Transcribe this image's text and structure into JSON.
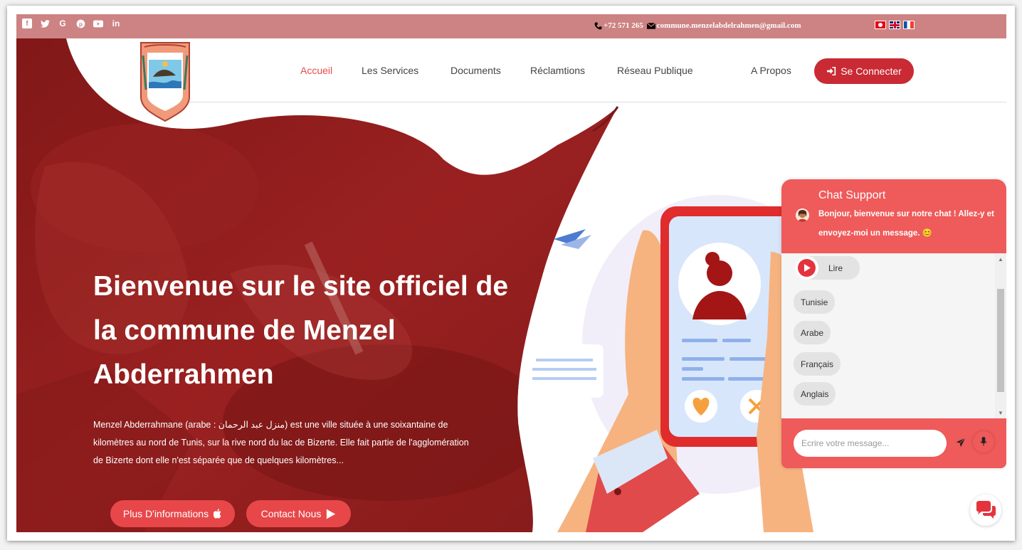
{
  "topbar": {
    "social": [
      {
        "icon": "facebook-icon",
        "glyph": "f"
      },
      {
        "icon": "twitter-icon",
        "glyph": "🐦"
      },
      {
        "icon": "google-icon",
        "glyph": "G"
      },
      {
        "icon": "pinterest-icon",
        "glyph": "℗"
      },
      {
        "icon": "youtube-icon",
        "glyph": "▶"
      },
      {
        "icon": "linkedin-icon",
        "glyph": "in"
      }
    ],
    "phone": "+72 571 265",
    "email": "commune.menzelabdelrahmen@gmail.com",
    "flags": [
      "tunisia-flag-icon",
      "uk-flag-icon",
      "france-flag-icon"
    ]
  },
  "nav": {
    "items": [
      "Accueil",
      "Les Services",
      "Documents",
      "Réclamtions",
      "Réseau Publique",
      "A Propos"
    ],
    "active": "Accueil",
    "login_label": "Se Connecter"
  },
  "hero": {
    "title": "Bienvenue sur le site officiel de la commune de Menzel Abderrahmen",
    "description": "Menzel Abderrahmane (arabe : منزل عبد الرحمان) est une ville située à une soixantaine de kilomètres au nord de Tunis, sur la rive nord du lac de Bizerte. Elle fait partie de l'agglomération de Bizerte dont elle n'est séparée que de quelques kilomètres...",
    "btn_info": "Plus D'informations",
    "btn_contact": "Contact Nous"
  },
  "chat": {
    "title": "Chat Support",
    "welcome": "Bonjour, bienvenue sur notre chat ! Allez-y et envoyez-moi un message. 😊",
    "read_label": "Lire",
    "options": [
      "Tunisie",
      "Arabe",
      "Français",
      "Anglais"
    ],
    "input_placeholder": "Ecrire votre message..."
  },
  "colors": {
    "topbar": "#cd8383",
    "accent": "#e8474a",
    "chat": "#ef5a5a",
    "hero_overlay": "#8e1c1c"
  }
}
